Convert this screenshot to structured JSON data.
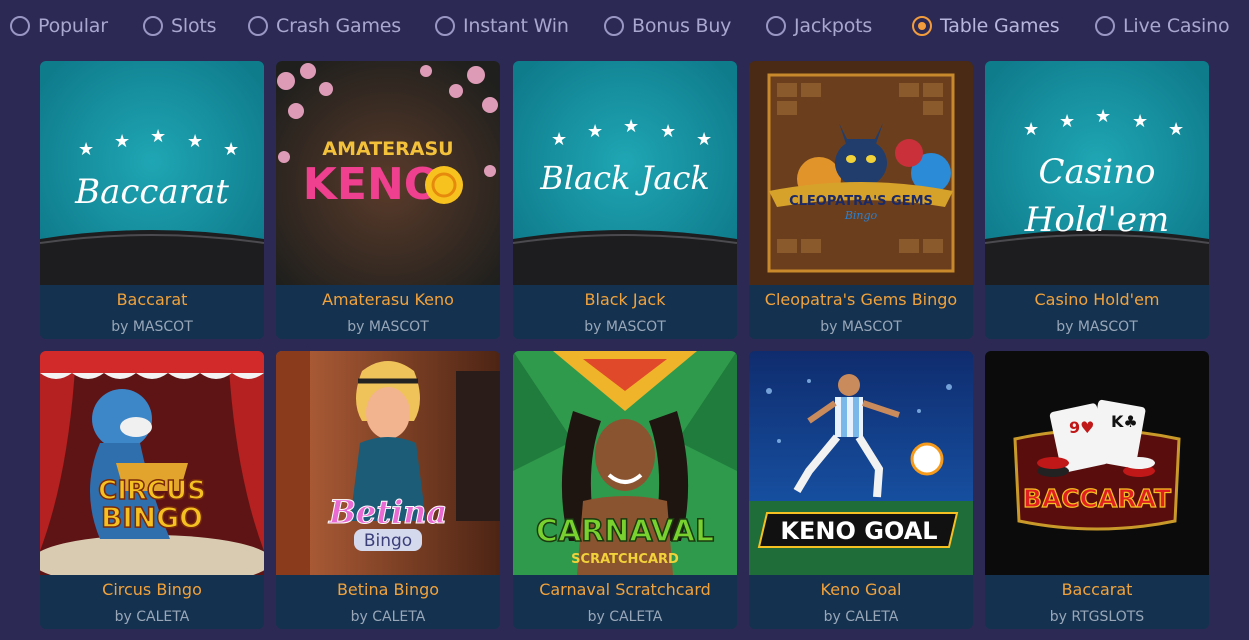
{
  "tabs": [
    {
      "label": "Popular",
      "selected": false
    },
    {
      "label": "Slots",
      "selected": false
    },
    {
      "label": "Crash Games",
      "selected": false
    },
    {
      "label": "Instant Win",
      "selected": false
    },
    {
      "label": "Bonus Buy",
      "selected": false
    },
    {
      "label": "Jackpots",
      "selected": false
    },
    {
      "label": "Table Games",
      "selected": true
    },
    {
      "label": "Live Casino",
      "selected": false
    }
  ],
  "games": [
    {
      "name": "Baccarat",
      "provider": "by MASCOT",
      "art_text": [
        "Baccarat"
      ]
    },
    {
      "name": "Amaterasu Keno",
      "provider": "by MASCOT",
      "art_text": [
        "AMATERASU",
        "KENO"
      ]
    },
    {
      "name": "Black Jack",
      "provider": "by MASCOT",
      "art_text": [
        "Black Jack"
      ]
    },
    {
      "name": "Cleopatra's Gems Bingo",
      "provider": "by MASCOT",
      "art_text": [
        "CLEOPATRA'S GEMS",
        "Bingo"
      ]
    },
    {
      "name": "Casino Hold'em",
      "provider": "by MASCOT",
      "art_text": [
        "Casino",
        "Hold'em"
      ]
    },
    {
      "name": "Circus Bingo",
      "provider": "by CALETA",
      "art_text": [
        "CIRCUS",
        "BINGO"
      ]
    },
    {
      "name": "Betina Bingo",
      "provider": "by CALETA",
      "art_text": [
        "Betina",
        "Bingo"
      ]
    },
    {
      "name": "Carnaval Scratchcard",
      "provider": "by CALETA",
      "art_text": [
        "CARNAVAL",
        "SCRATCHCARD"
      ]
    },
    {
      "name": "Keno Goal",
      "provider": "by CALETA",
      "art_text": [
        "KENO GOAL"
      ]
    },
    {
      "name": "Baccarat",
      "provider": "by RTGSLOTS",
      "art_text": [
        "BACCARAT"
      ]
    }
  ],
  "colors": {
    "background": "#2c2a55",
    "accent": "#f39c3c",
    "game_name": "#f2a23a",
    "provider": "#98a6b8",
    "card_footer": "#14324f"
  }
}
